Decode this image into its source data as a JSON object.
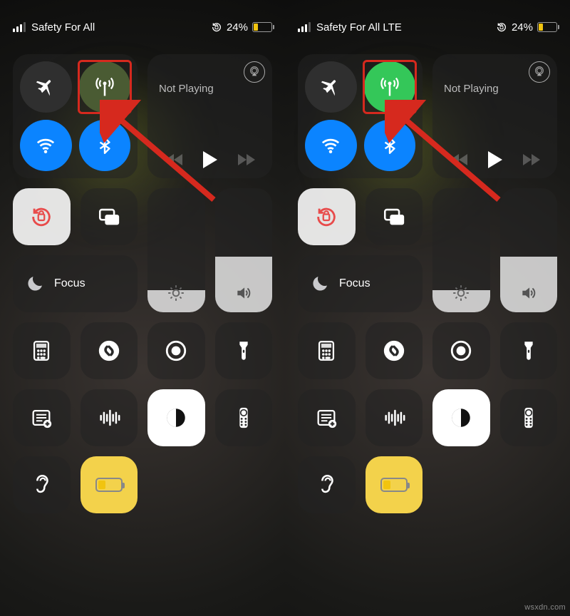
{
  "watermark": "wsxdn.com",
  "panels": [
    {
      "id": "left",
      "carrier": "Safety For All",
      "battery_pct": "24%",
      "battery_fill_pct": 24,
      "cellular_active": false,
      "wifi_active": true,
      "bt_active": true,
      "media_label": "Not Playing",
      "focus_label": "Focus",
      "volume_level_pct": 45,
      "brightness_level_pct": 15
    },
    {
      "id": "right",
      "carrier": "Safety For All LTE",
      "battery_pct": "24%",
      "battery_fill_pct": 24,
      "cellular_active": true,
      "wifi_active": true,
      "bt_active": true,
      "media_label": "Not Playing",
      "focus_label": "Focus",
      "volume_level_pct": 45,
      "brightness_level_pct": 15
    }
  ],
  "icons": {
    "airplane": "airplane-icon",
    "cellular": "antenna-icon",
    "wifi": "wifi-icon",
    "bluetooth": "bluetooth-icon",
    "airplay": "airplay-icon",
    "orientation_lock": "rotation-lock-icon",
    "screen_mirroring": "screen-mirroring-icon",
    "focus": "moon-icon",
    "brightness": "sun-icon",
    "volume": "speaker-icon",
    "calculator": "calculator-icon",
    "shazam": "shazam-icon",
    "screen_record": "record-icon",
    "flashlight": "flashlight-icon",
    "notes": "notes-icon",
    "voice_memos": "waveform-icon",
    "dark_mode": "dark-mode-icon",
    "remote": "remote-icon",
    "hearing": "ear-icon",
    "low_power": "low-power-icon"
  }
}
